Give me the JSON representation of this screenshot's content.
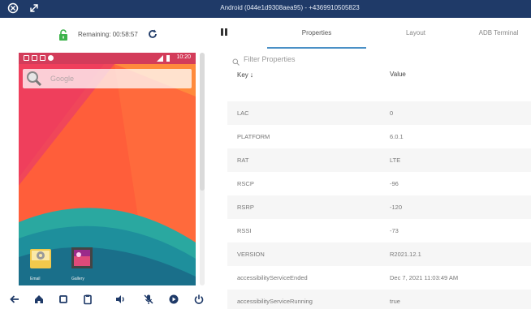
{
  "window": {
    "title": "Android (044e1d9308aea95) - +4369910505823"
  },
  "session": {
    "remaining_label": "Remaining: 00:58:57"
  },
  "device_screen": {
    "status_time": "10:20",
    "search_placeholder": "Google",
    "apps": [
      {
        "label": "Email"
      },
      {
        "label": "Gallery"
      }
    ]
  },
  "tabs": [
    {
      "label": "Properties",
      "active": true
    },
    {
      "label": "Layout",
      "active": false
    },
    {
      "label": "ADB Terminal",
      "active": false
    }
  ],
  "filter": {
    "placeholder": "Filter Properties"
  },
  "table": {
    "key_header": "Key",
    "value_header": "Value",
    "rows": [
      {
        "key": "",
        "value": ""
      },
      {
        "key": "LAC",
        "value": "0"
      },
      {
        "key": "PLATFORM",
        "value": "6.0.1"
      },
      {
        "key": "RAT",
        "value": "LTE"
      },
      {
        "key": "RSCP",
        "value": "-96"
      },
      {
        "key": "RSRP",
        "value": "-120"
      },
      {
        "key": "RSSI",
        "value": "-73"
      },
      {
        "key": "VERSION",
        "value": "R2021.12.1"
      },
      {
        "key": "accessibilityServiceEnded",
        "value": "Dec 7, 2021 11:03:49 AM"
      },
      {
        "key": "accessibilityServiceRunning",
        "value": "true"
      }
    ]
  },
  "colors": {
    "titlebar": "#1f3a68",
    "accent": "#4a90c6",
    "device_statusbar": "#d33c5a",
    "lock_green": "#3cb34a"
  },
  "icons": [
    "close-icon",
    "expand-icon",
    "lock-icon",
    "refresh-icon",
    "pause-icon",
    "search-icon",
    "arrow-down-icon",
    "back-icon",
    "home-icon",
    "square-icon",
    "clipboard-icon",
    "volume-icon",
    "mic-off-icon",
    "record-icon",
    "power-icon"
  ]
}
